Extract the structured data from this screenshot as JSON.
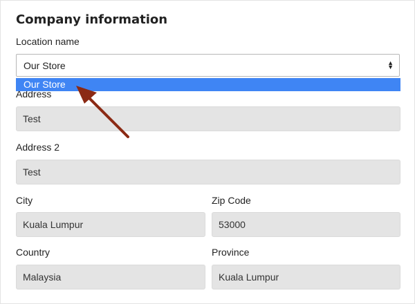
{
  "section": {
    "title": "Company information"
  },
  "location": {
    "label": "Location name",
    "selected": "Our Store",
    "options": [
      "Our Store"
    ],
    "highlight_color": "#3f85f4"
  },
  "address": {
    "label": "Address",
    "value": "Test"
  },
  "address2": {
    "label": "Address 2",
    "value": "Test"
  },
  "city": {
    "label": "City",
    "value": "Kuala Lumpur"
  },
  "zip": {
    "label": "Zip Code",
    "value": "53000"
  },
  "country": {
    "label": "Country",
    "value": "Malaysia"
  },
  "province": {
    "label": "Province",
    "value": "Kuala Lumpur"
  },
  "annotation": {
    "arrow_color": "#8b2a14",
    "icon": "pointer-arrow-icon"
  }
}
